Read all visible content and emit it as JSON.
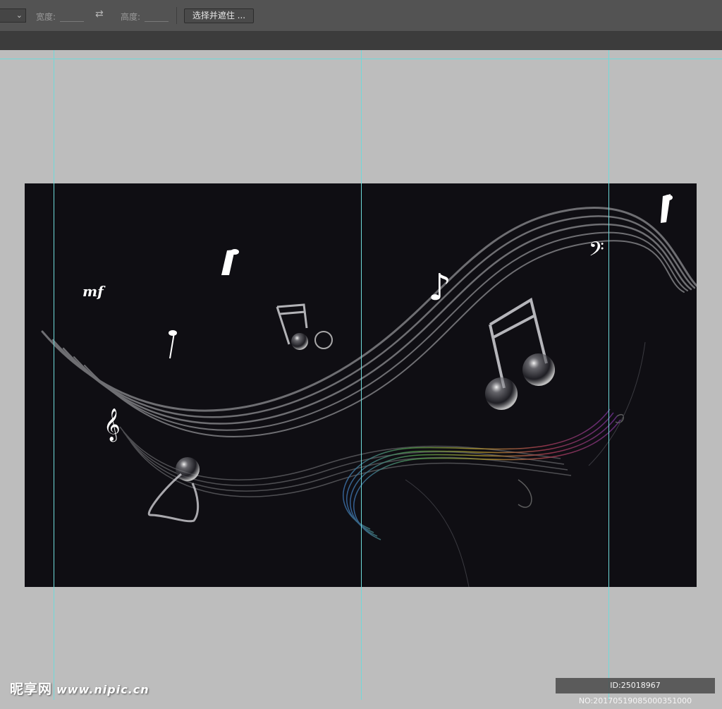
{
  "options_bar": {
    "width_label": "宽度:",
    "height_label": "高度:",
    "select_mask_button": "选择并遮住 ..."
  },
  "canvas": {
    "background": "#0f0e13",
    "dynamic_marking": "mf",
    "treble_clef": "𝄞",
    "bass_clef": "𝄢",
    "eighth_note": "♪"
  },
  "watermark": {
    "logo": "昵享网",
    "site": "www.nipic.cn",
    "id": "ID:25018967 NO:20170519085000351000"
  },
  "colors": {
    "guide": "#6fdada",
    "workspace": "#bdbdbd",
    "options_bar": "#535353"
  }
}
